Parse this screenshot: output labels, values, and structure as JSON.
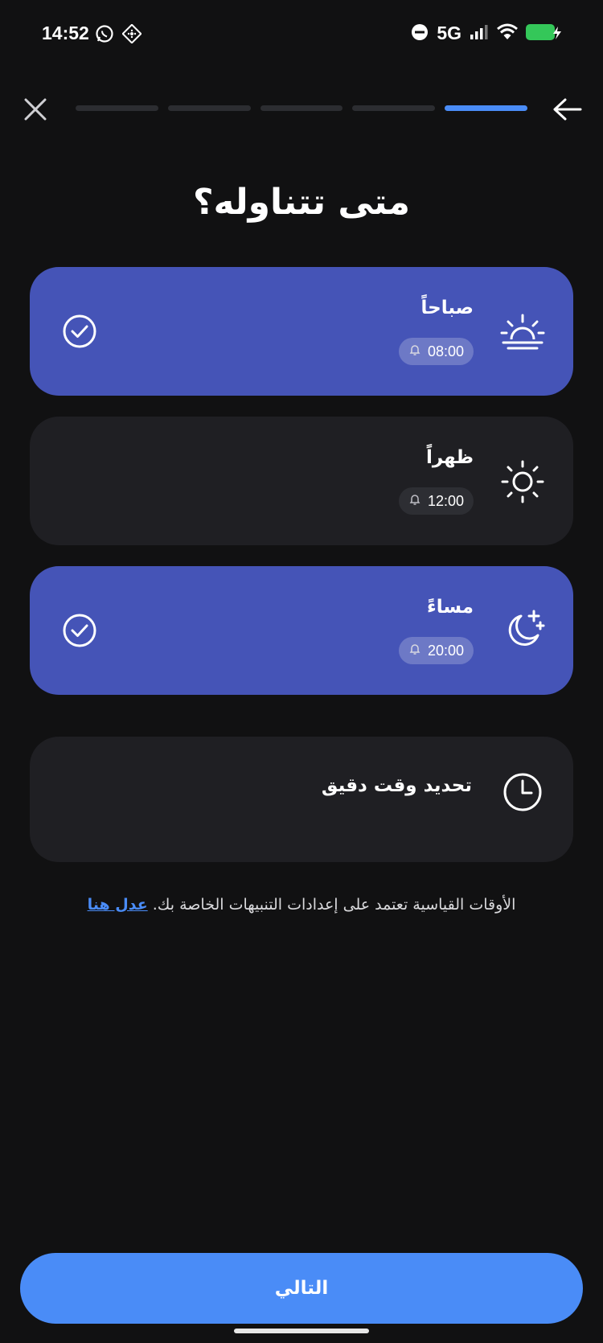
{
  "status_bar": {
    "time": "14:52",
    "network": "5G",
    "left_icons": [
      "whatsapp-icon",
      "app-notification-icon"
    ],
    "right_icons": [
      "do-not-disturb-icon",
      "signal-icon",
      "wifi-icon",
      "battery-charging-icon"
    ],
    "battery_color": "#34c759"
  },
  "nav": {
    "progress_total": 5,
    "progress_current": 5,
    "accent": "#4a8cf7"
  },
  "page": {
    "title": "متى تتناوله؟"
  },
  "options": [
    {
      "title": "صباحاً",
      "time": "08:00",
      "selected": true,
      "icon": "sunrise-icon"
    },
    {
      "title": "ظهراً",
      "time": "12:00",
      "selected": false,
      "icon": "sun-icon"
    },
    {
      "title": "مساءً",
      "time": "20:00",
      "selected": true,
      "icon": "moon-star-icon"
    }
  ],
  "custom_time": {
    "label": "تحديد وقت دقيق",
    "icon": "clock-icon"
  },
  "note": {
    "text": "الأوقات القياسية تعتمد على إعدادات التنبيهات الخاصة بك.",
    "link": "عدل هنا"
  },
  "footer": {
    "next_label": "التالي"
  },
  "colors": {
    "background": "#111112",
    "card": "#1f1f23",
    "card_selected": "#4554b7",
    "primary_button": "#4a8cf7"
  }
}
